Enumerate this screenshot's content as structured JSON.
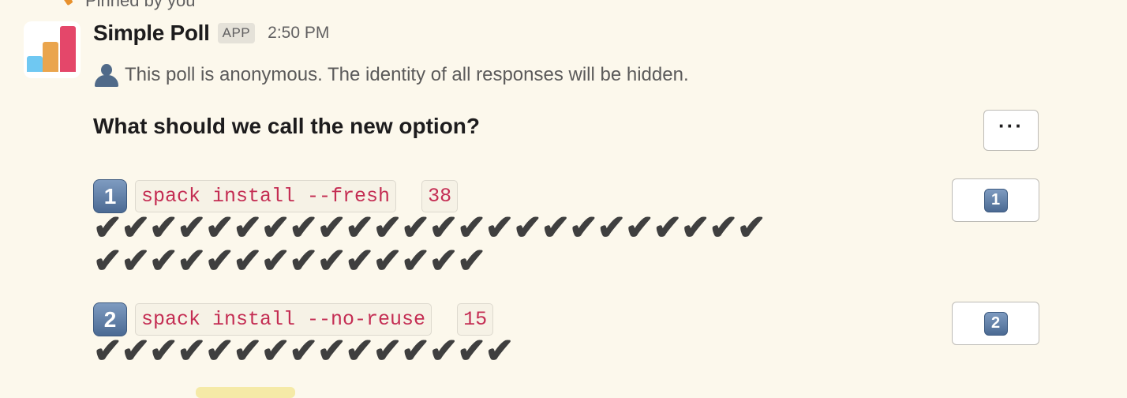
{
  "pinned": {
    "label": "Pinned by you",
    "icon": "pin-icon"
  },
  "message": {
    "app_name": "Simple Poll",
    "app_badge": "APP",
    "time": "2:50 PM",
    "anon_icon": "person-silhouette-icon",
    "anon_text": "This poll is anonymous. The identity of all responses will be hidden.",
    "question": "What should we call the new option?",
    "more_button_label": "···"
  },
  "options": [
    {
      "number": "1",
      "text": "spack install --fresh",
      "count": "38",
      "checks_line1": "✔✔✔✔✔✔✔✔✔✔✔✔✔✔✔✔✔✔✔✔✔✔✔✔",
      "checks_line2": "✔✔✔✔✔✔✔✔✔✔✔✔✔✔",
      "vote_label": "1"
    },
    {
      "number": "2",
      "text": "spack install --no-reuse",
      "count": "15",
      "checks_line1": "✔✔✔✔✔✔✔✔✔✔✔✔✔✔✔",
      "vote_label": "2"
    }
  ],
  "colors": {
    "background": "#fcf8ec",
    "code_text": "#c42d53",
    "keycap": "#5b7aa3"
  }
}
